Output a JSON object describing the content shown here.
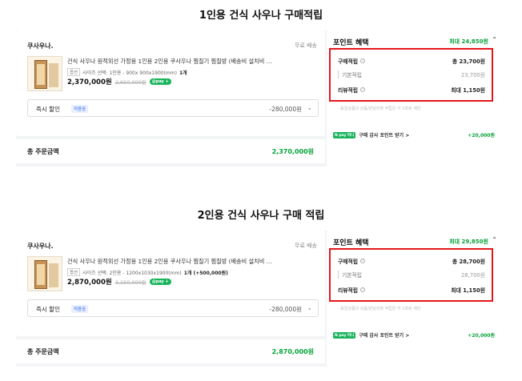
{
  "sections": [
    {
      "title": "1인용 건식 사우나 구매적립",
      "order": {
        "shop_name": "쿠사우나.",
        "shipping": "무료 배송",
        "product_name": "건식 사우나 원적외선 가정용 1인용 2인용 쿠사우나 찜질기 찜질방 (배송비 설치비 ...",
        "option_tag": "옵션",
        "option_text": "사이즈 선택: 1인용 - 900x 900x1900(mm)",
        "quantity": "1개",
        "price": "2,370,000원",
        "original_price": "2,650,000원",
        "pay_badge": "@pay +",
        "discount_label": "즉시 할인",
        "discount_badge": "적용중",
        "discount_amount": "-280,000원",
        "total_label": "총 주문금액",
        "total_value": "2,370,000원"
      },
      "points": {
        "title": "포인트 혜택",
        "max": "최대 24,850원",
        "purchase_label": "구매적립",
        "purchase_value": "총 23,700원",
        "basic_label": "기본적립",
        "basic_value": "23,700원",
        "review_label": "리뷰적립",
        "review_value": "최대 1,150원",
        "note": "· 동일상품의 상품/판날리뷰 적립은 각 1회로 제한",
        "coupon_logo": "N pay 머니",
        "coupon_text": "구매 감사 포인트 받기 >",
        "coupon_value": "+20,000원"
      }
    },
    {
      "title": "2인용 건식 사우나 구매 적립",
      "order": {
        "shop_name": "쿠사우나.",
        "shipping": "무료 배송",
        "product_name": "건식 사우나 원적외선 가정용 1인용 2인용 쿠사우나 찜질기 찜질방 (배송비 설치비 ...",
        "option_tag": "옵션",
        "option_text": "사이즈 선택: 2인용 - 1200x1030x1900(mm)",
        "quantity": "1개 (+500,000원)",
        "price": "2,870,000원",
        "original_price": "3,150,000원",
        "pay_badge": "@pay +",
        "discount_label": "즉시 할인",
        "discount_badge": "적용중",
        "discount_amount": "-280,000원",
        "total_label": "총 주문금액",
        "total_value": "2,870,000원"
      },
      "points": {
        "title": "포인트 혜택",
        "max": "최대 29,850원",
        "purchase_label": "구매적립",
        "purchase_value": "총 28,700원",
        "basic_label": "기본적립",
        "basic_value": "28,700원",
        "review_label": "리뷰적립",
        "review_value": "최대 1,150원",
        "note": "· 동일상품의 상품/판날리뷰 적립은 각 1회로 제한",
        "coupon_logo": "N pay 머니",
        "coupon_text": "구매 감사 포인트 받기 >",
        "coupon_value": "+20,000원"
      }
    }
  ],
  "icons": {
    "chevron_up": "chevron-up-icon",
    "chevron_down": "chevron-down-icon",
    "info": "info-icon"
  },
  "colors": {
    "highlight": "#e5171b",
    "accent_green": "#07a33a",
    "panel_bg": "#f3f4f6"
  }
}
